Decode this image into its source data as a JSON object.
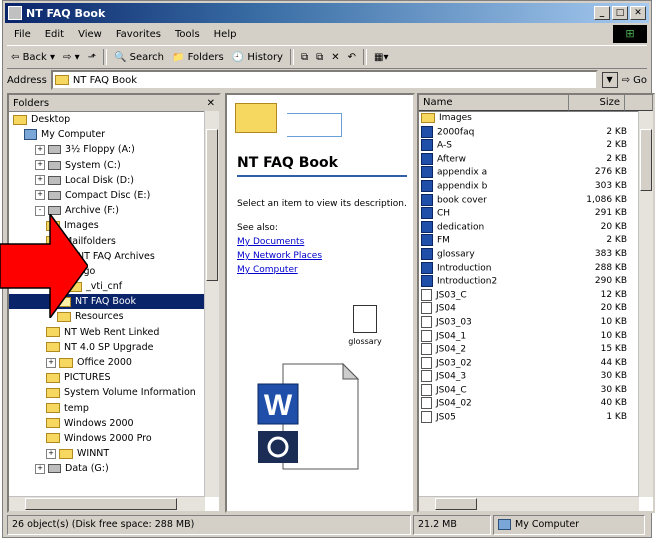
{
  "window": {
    "title": "NT FAQ Book"
  },
  "menu": [
    "File",
    "Edit",
    "View",
    "Favorites",
    "Tools",
    "Help"
  ],
  "toolbar": {
    "back": "Back",
    "search": "Search",
    "folders": "Folders",
    "history": "History"
  },
  "address": {
    "label": "Address",
    "value": "NT FAQ Book"
  },
  "folders_pane": {
    "title": "Folders",
    "tree": [
      {
        "label": "Desktop",
        "indent": 0,
        "exp": "",
        "icon": "folder"
      },
      {
        "label": "My Computer",
        "indent": 1,
        "exp": "",
        "icon": "computer"
      },
      {
        "label": "3½ Floppy (A:)",
        "indent": 2,
        "exp": "+",
        "icon": "drive"
      },
      {
        "label": "System (C:)",
        "indent": 2,
        "exp": "+",
        "icon": "drive"
      },
      {
        "label": "Local Disk (D:)",
        "indent": 2,
        "exp": "+",
        "icon": "drive"
      },
      {
        "label": "Compact Disc (E:)",
        "indent": 2,
        "exp": "+",
        "icon": "drive"
      },
      {
        "label": "Archive (F:)",
        "indent": 2,
        "exp": "-",
        "icon": "drive"
      },
      {
        "label": "Images",
        "indent": 3,
        "exp": "",
        "icon": "folder"
      },
      {
        "label": "Mailfolders",
        "indent": 3,
        "exp": "",
        "icon": "folder"
      },
      {
        "label": "NT FAQ Archives",
        "indent": 3,
        "exp": "-",
        "icon": "folder"
      },
      {
        "label": "logo",
        "indent": 4,
        "exp": "",
        "icon": "folder"
      },
      {
        "label": "_vti_cnf",
        "indent": 5,
        "exp": "",
        "icon": "folder"
      },
      {
        "label": "NT FAQ Book",
        "indent": 4,
        "exp": "",
        "icon": "folder",
        "selected": true
      },
      {
        "label": "Resources",
        "indent": 4,
        "exp": "",
        "icon": "folder"
      },
      {
        "label": "NT Web Rent Linked",
        "indent": 3,
        "exp": "",
        "icon": "folder"
      },
      {
        "label": "NT 4.0 SP Upgrade",
        "indent": 3,
        "exp": "",
        "icon": "folder"
      },
      {
        "label": "Office 2000",
        "indent": 3,
        "exp": "+",
        "icon": "folder"
      },
      {
        "label": "PICTURES",
        "indent": 3,
        "exp": "",
        "icon": "folder"
      },
      {
        "label": "System Volume Information",
        "indent": 3,
        "exp": "",
        "icon": "folder"
      },
      {
        "label": "temp",
        "indent": 3,
        "exp": "",
        "icon": "folder"
      },
      {
        "label": "Windows 2000",
        "indent": 3,
        "exp": "",
        "icon": "folder"
      },
      {
        "label": "Windows 2000 Pro",
        "indent": 3,
        "exp": "",
        "icon": "folder"
      },
      {
        "label": "WINNT",
        "indent": 3,
        "exp": "+",
        "icon": "folder"
      },
      {
        "label": "Data (G:)",
        "indent": 2,
        "exp": "+",
        "icon": "drive"
      }
    ]
  },
  "webview": {
    "title": "NT FAQ Book",
    "prompt": "Select an item to view its description.",
    "see_also": "See also:",
    "links": [
      "My Documents",
      "My Network Places",
      "My Computer"
    ],
    "glossary_label": "glossary"
  },
  "files_pane": {
    "col_name": "Name",
    "col_size": "Size",
    "rows": [
      {
        "name": "Images",
        "size": "",
        "icon": "folder"
      },
      {
        "name": "2000faq",
        "size": "2 KB",
        "icon": "word"
      },
      {
        "name": "A-S",
        "size": "2 KB",
        "icon": "word"
      },
      {
        "name": "Afterw",
        "size": "2 KB",
        "icon": "word"
      },
      {
        "name": "appendix a",
        "size": "276 KB",
        "icon": "word"
      },
      {
        "name": "appendix b",
        "size": "303 KB",
        "icon": "word"
      },
      {
        "name": "book cover",
        "size": "1,086 KB",
        "icon": "word"
      },
      {
        "name": "CH",
        "size": "291 KB",
        "icon": "word"
      },
      {
        "name": "dedication",
        "size": "20 KB",
        "icon": "word"
      },
      {
        "name": "FM",
        "size": "2 KB",
        "icon": "word"
      },
      {
        "name": "glossary",
        "size": "383 KB",
        "icon": "word"
      },
      {
        "name": "Introduction",
        "size": "288 KB",
        "icon": "word"
      },
      {
        "name": "Introduction2",
        "size": "290 KB",
        "icon": "word"
      },
      {
        "name": "JS03_C",
        "size": "12 KB",
        "icon": "doc"
      },
      {
        "name": "JS04",
        "size": "20 KB",
        "icon": "doc"
      },
      {
        "name": "JS03_03",
        "size": "10 KB",
        "icon": "doc"
      },
      {
        "name": "JS04_1",
        "size": "10 KB",
        "icon": "doc"
      },
      {
        "name": "JS04_2",
        "size": "15 KB",
        "icon": "doc"
      },
      {
        "name": "JS03_02",
        "size": "44 KB",
        "icon": "doc"
      },
      {
        "name": "JS04_3",
        "size": "30 KB",
        "icon": "doc"
      },
      {
        "name": "JS04_C",
        "size": "30 KB",
        "icon": "doc"
      },
      {
        "name": "JS04_02",
        "size": "40 KB",
        "icon": "doc"
      },
      {
        "name": "JS05",
        "size": "1 KB",
        "icon": "doc"
      }
    ]
  },
  "statusbar": {
    "left": "26 object(s) (Disk free space: 288 MB)",
    "size": "21.2 MB",
    "zone": "My Computer"
  },
  "colors": {
    "accent": "#0a246a",
    "arrow": "#ff0000"
  }
}
